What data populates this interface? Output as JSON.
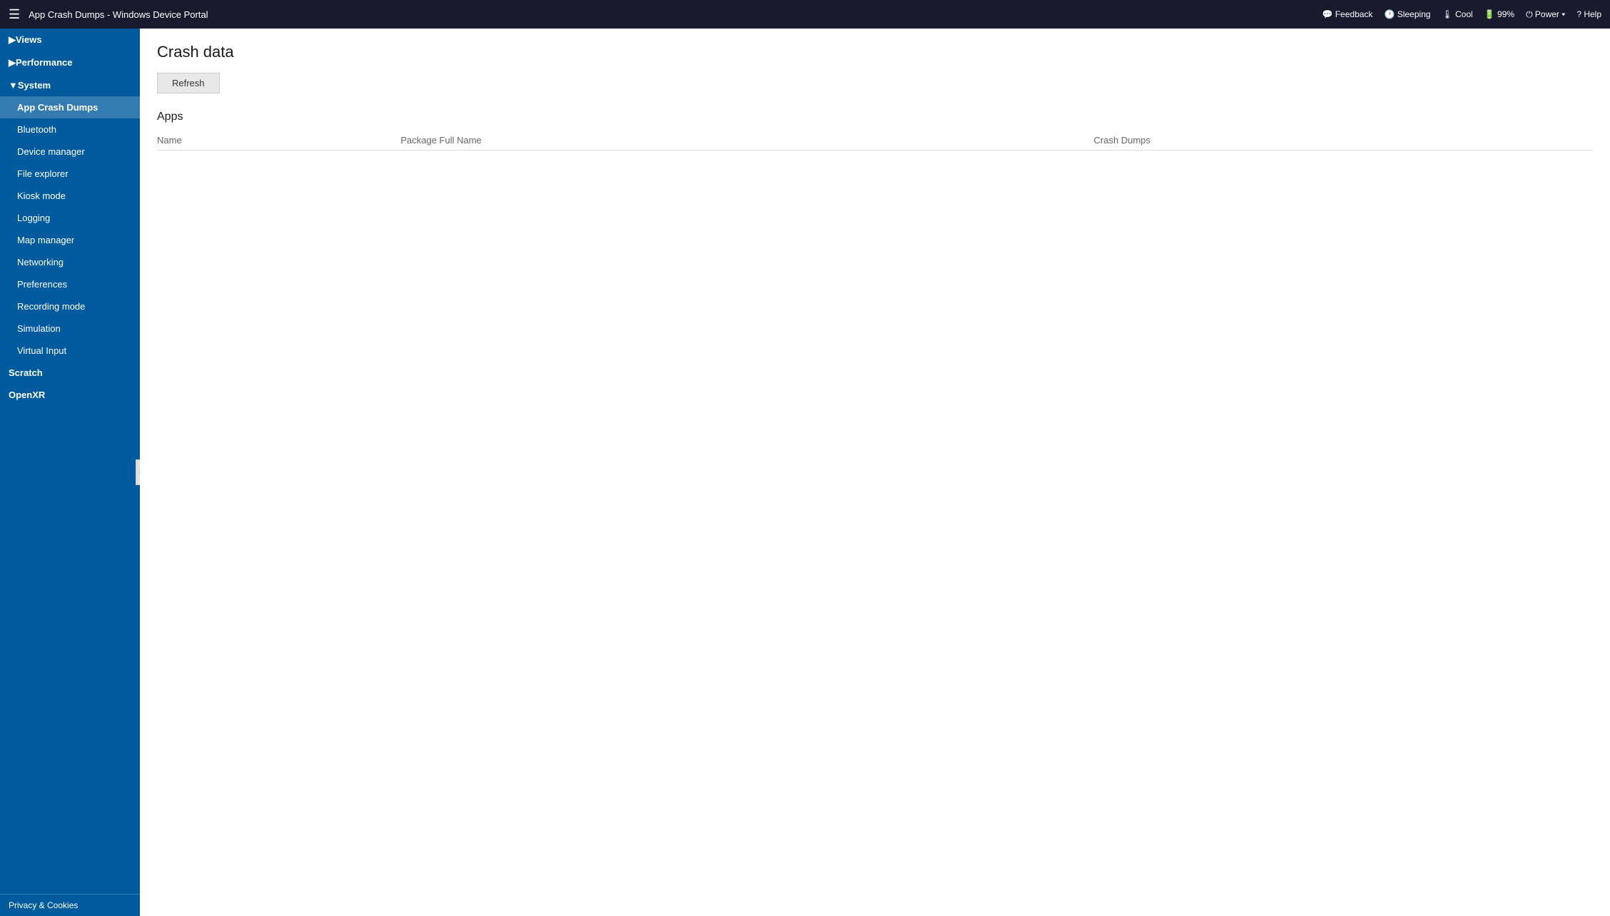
{
  "topbar": {
    "hamburger": "☰",
    "title": "App Crash Dumps - Windows Device Portal",
    "actions": [
      {
        "id": "feedback",
        "icon": "💬",
        "label": "Feedback"
      },
      {
        "id": "sleeping",
        "icon": "🕐",
        "label": "Sleeping"
      },
      {
        "id": "cool",
        "icon": "🌡",
        "label": "Cool"
      },
      {
        "id": "battery",
        "icon": "🔋",
        "label": "99%"
      },
      {
        "id": "power",
        "icon": "⏻",
        "label": "Power ▾"
      },
      {
        "id": "help",
        "icon": "?",
        "label": "Help"
      }
    ]
  },
  "sidebar": {
    "collapse_icon": "◀",
    "sections": [
      {
        "id": "views",
        "label": "▶Views",
        "expanded": false,
        "items": []
      },
      {
        "id": "performance",
        "label": "▶Performance",
        "expanded": false,
        "items": []
      },
      {
        "id": "system",
        "label": "▼System",
        "expanded": true,
        "items": [
          {
            "id": "app-crash-dumps",
            "label": "App Crash Dumps",
            "active": true
          },
          {
            "id": "bluetooth",
            "label": "Bluetooth",
            "active": false
          },
          {
            "id": "device-manager",
            "label": "Device manager",
            "active": false
          },
          {
            "id": "file-explorer",
            "label": "File explorer",
            "active": false
          },
          {
            "id": "kiosk-mode",
            "label": "Kiosk mode",
            "active": false
          },
          {
            "id": "logging",
            "label": "Logging",
            "active": false
          },
          {
            "id": "map-manager",
            "label": "Map manager",
            "active": false
          },
          {
            "id": "networking",
            "label": "Networking",
            "active": false
          },
          {
            "id": "preferences",
            "label": "Preferences",
            "active": false
          },
          {
            "id": "recording-mode",
            "label": "Recording mode",
            "active": false
          },
          {
            "id": "simulation",
            "label": "Simulation",
            "active": false
          },
          {
            "id": "virtual-input",
            "label": "Virtual Input",
            "active": false
          }
        ]
      },
      {
        "id": "scratch",
        "label": "Scratch",
        "expanded": false,
        "items": []
      },
      {
        "id": "openxr",
        "label": "OpenXR",
        "expanded": false,
        "items": []
      }
    ],
    "bottom_link": "Privacy & Cookies"
  },
  "content": {
    "page_title": "Crash data",
    "refresh_button": "Refresh",
    "section_title": "Apps",
    "table": {
      "columns": [
        "Name",
        "Package Full Name",
        "Crash Dumps"
      ],
      "rows": []
    }
  }
}
